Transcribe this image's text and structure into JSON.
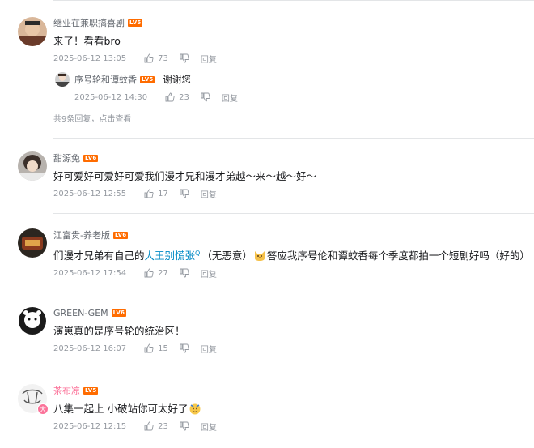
{
  "comments": [
    {
      "username": "继业在兼职搞喜剧",
      "level": "LV5",
      "content": "来了！看看bro",
      "time": "2025-06-12 13:05",
      "likes": "73",
      "reply_label": "回复",
      "sub_reply": {
        "username": "序号轮和谭蚊香",
        "level": "LV5",
        "content": "谢谢您",
        "time": "2025-06-12 14:30",
        "likes": "23",
        "reply_label": "回复"
      },
      "more_replies": "共9条回复，点击查看"
    },
    {
      "username": "甜源兔",
      "level": "LV6",
      "content": "好可爱好可爱好可爱我们漫才兄和漫才弟越～来～越～好～",
      "time": "2025-06-12 12:55",
      "likes": "17",
      "reply_label": "回复"
    },
    {
      "username": "江富贵-养老版",
      "level": "LV6",
      "content_pre": "们漫才兄弟有自己的",
      "content_at": "大王别慌张",
      "content_at_mark": "Q",
      "content_mid": "（无恶意）",
      "content_post": "答应我序号伦和谭蚊香每个季度都拍一个短剧好吗（好的）",
      "time": "2025-06-12 17:54",
      "likes": "27",
      "reply_label": "回复"
    },
    {
      "username": "GREEN-GEM",
      "level": "LV6",
      "content": "演崽真的是序号轮的统治区！",
      "time": "2025-06-12 16:07",
      "likes": "15",
      "reply_label": "回复"
    },
    {
      "username": "茶布凉",
      "level": "LV5",
      "content": "八集一起上 小破站你可太好了",
      "time": "2025-06-12 12:15",
      "likes": "23",
      "reply_label": "回复",
      "avatar_badge": "大"
    }
  ],
  "colors": {
    "level_badge": "#ff6c00",
    "link": "#008ac5",
    "vip_name": "#fb7299",
    "meta": "#9499a0"
  },
  "icons": [
    "thumb-up-icon",
    "thumb-down-icon",
    "cat-emoji-icon",
    "party-emoji-icon"
  ]
}
